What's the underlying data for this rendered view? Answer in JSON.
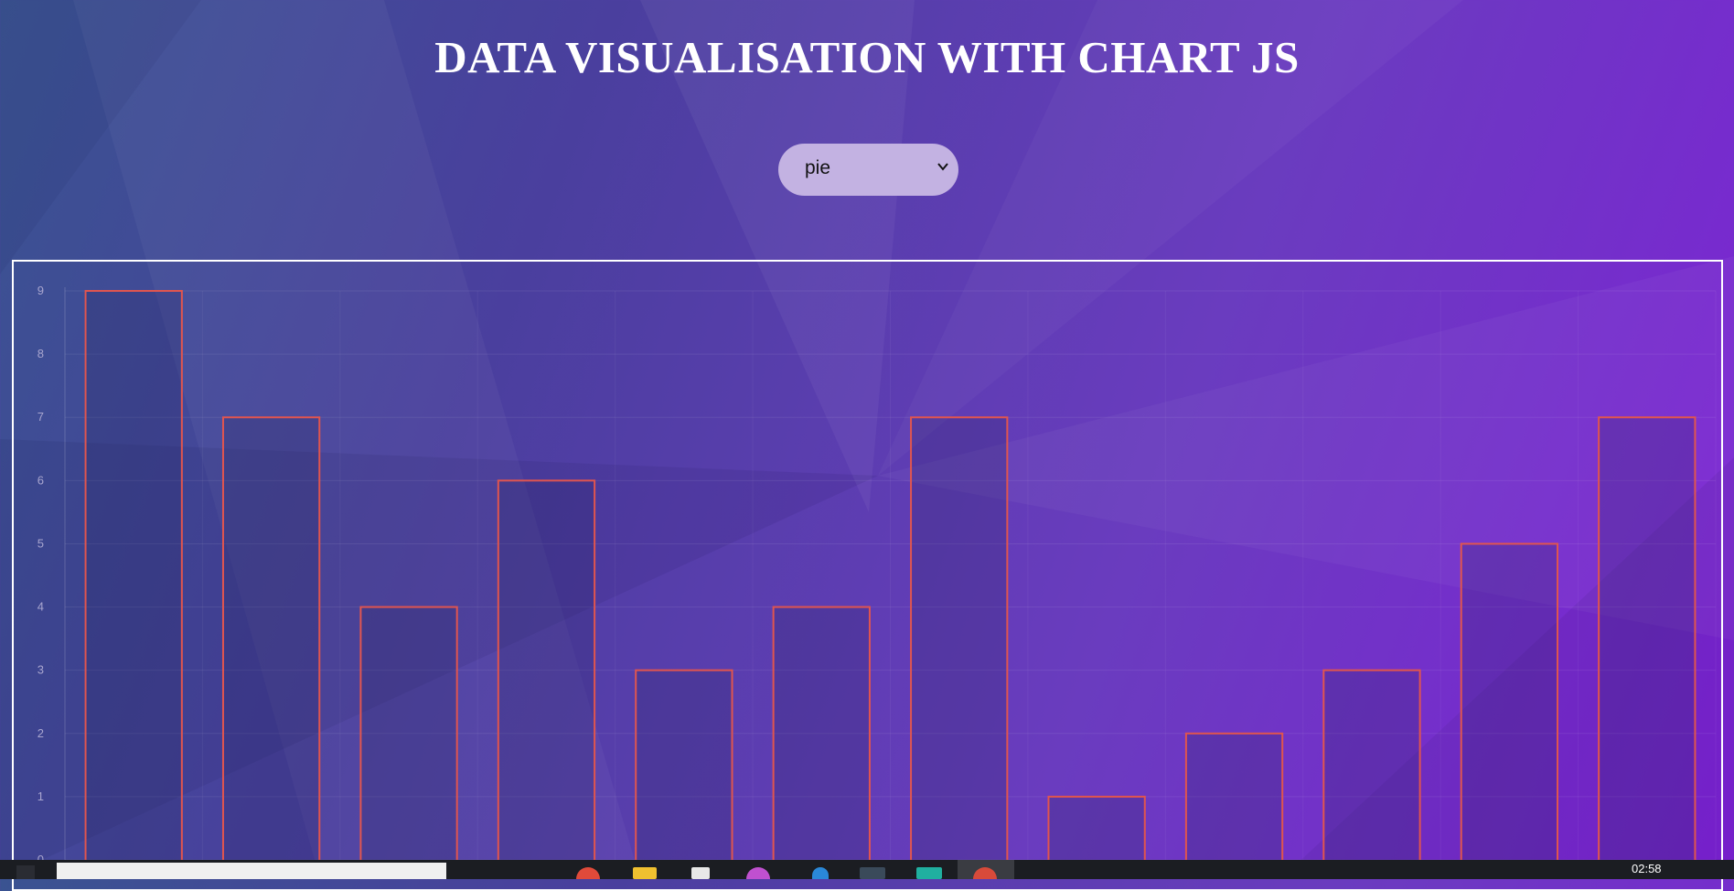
{
  "page": {
    "title": "DATA VISUALISATION WITH CHART JS"
  },
  "chart_type_select": {
    "value": "pie"
  },
  "chart_data": {
    "type": "bar",
    "categories": [
      "",
      "",
      "",
      "",
      "",
      "",
      "",
      "",
      "",
      "",
      "",
      ""
    ],
    "values": [
      9,
      7,
      4,
      6,
      3,
      4,
      7,
      1,
      2,
      3,
      5,
      7
    ],
    "yticks": [
      "0",
      "1",
      "2",
      "3",
      "4",
      "5",
      "6",
      "7",
      "8",
      "9"
    ],
    "ylim": [
      0,
      9
    ],
    "grid": true,
    "bar_border_color": "#e0554f",
    "bar_fill_color": "rgba(40,40,100,0.25)",
    "tick_color": "#a9a6cf"
  },
  "taskbar": {
    "clock": "02:58",
    "icons": [
      "search-icon",
      "task-view-icon",
      "app-icon",
      "app-icon",
      "folder-icon",
      "file-icon",
      "app-icon",
      "app-icon",
      "app-icon",
      "app-icon",
      "app-icon"
    ]
  }
}
